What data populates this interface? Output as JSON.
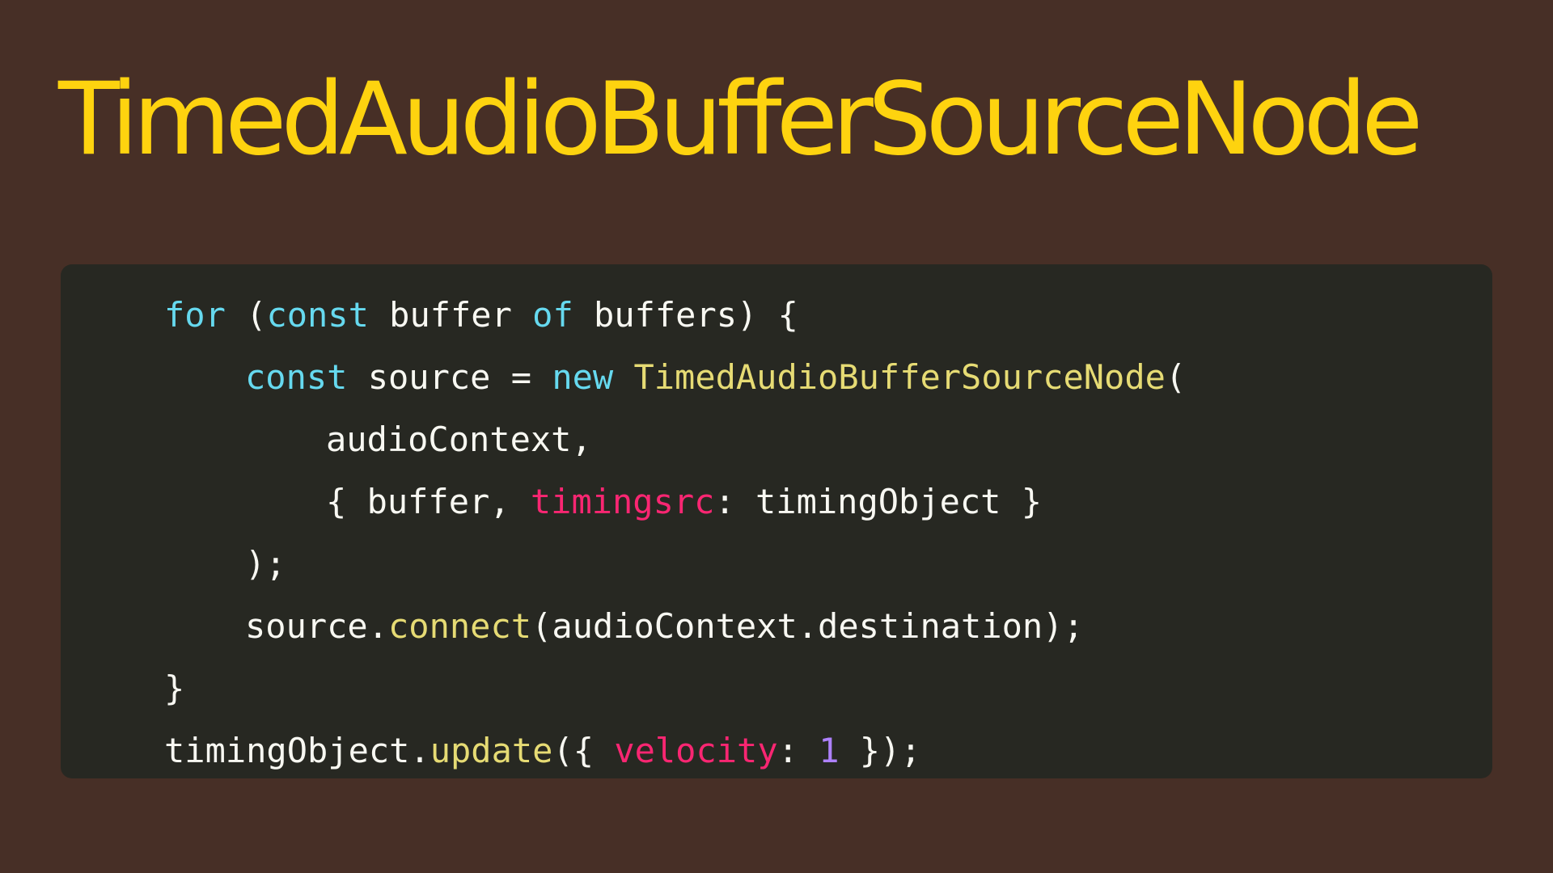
{
  "title": "TimedAudioBufferSourceNode",
  "colors": {
    "background": "#472f26",
    "title": "#fed30f",
    "code_background": "#272822",
    "keyword": "#66d9ef",
    "function": "#e6db74",
    "property": "#f92672",
    "number": "#ae81ff",
    "text": "#f8f8f2"
  },
  "code": {
    "line1": {
      "kw_for": "for",
      "t1": " (",
      "kw_const": "const",
      "t2": " buffer ",
      "kw_of": "of",
      "t3": " buffers) {"
    },
    "line2": {
      "kw_const": "const",
      "t1": " source = ",
      "kw_new": "new",
      "t2": " ",
      "fn_class": "TimedAudioBufferSourceNode",
      "t3": "("
    },
    "line3": {
      "t1": "audioContext,"
    },
    "line4": {
      "t1": "{ buffer, ",
      "prop_timingsrc": "timingsrc",
      "t2": ": timingObject }"
    },
    "line5": {
      "t1": ");"
    },
    "line6": {
      "t1": "source.",
      "fn_connect": "connect",
      "t2": "(audioContext.destination);"
    },
    "line7": {
      "t1": "}"
    },
    "line8": {
      "t1": "timingObject.",
      "fn_update": "update",
      "t2": "({ ",
      "prop_velocity": "velocity",
      "t3": ": ",
      "num_value": "1",
      "t4": " });"
    }
  }
}
